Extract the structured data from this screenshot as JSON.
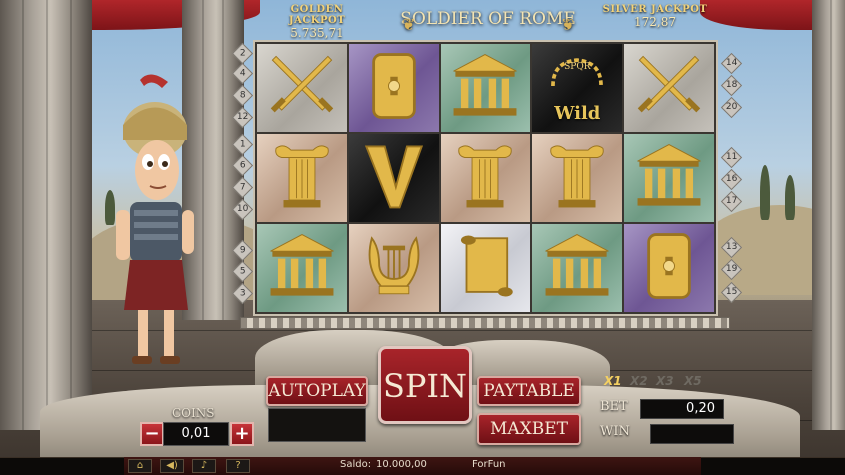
{
  "header": {
    "golden_jackpot_label": "GOLDEN JACKPOT",
    "golden_jackpot_value": "5.735,71",
    "title": "SOLDIER OF ROME",
    "silver_jackpot_label": "SILVER JACKPOT",
    "silver_jackpot_value": "172,87"
  },
  "paylines_left": [
    "2",
    "4",
    "8",
    "12",
    "1",
    "6",
    "7",
    "10",
    "9",
    "5",
    "3"
  ],
  "paylines_right": [
    "14",
    "18",
    "20",
    "11",
    "16",
    "17",
    "13",
    "19",
    "15"
  ],
  "reels": [
    [
      {
        "symbol": "crossed-swords",
        "bg": "gray"
      },
      {
        "symbol": "shield",
        "bg": "purple"
      },
      {
        "symbol": "temple",
        "bg": "green"
      },
      {
        "symbol": "spqr-wild",
        "bg": "black",
        "text": "Wild",
        "subtext": "SPQR"
      },
      {
        "symbol": "crossed-swords",
        "bg": "gray"
      }
    ],
    [
      {
        "symbol": "ionic-column",
        "bg": "tan"
      },
      {
        "symbol": "letter-v",
        "bg": "black"
      },
      {
        "symbol": "ionic-column",
        "bg": "tan"
      },
      {
        "symbol": "ionic-column",
        "bg": "tan"
      },
      {
        "symbol": "temple",
        "bg": "green"
      }
    ],
    [
      {
        "symbol": "temple",
        "bg": "green"
      },
      {
        "symbol": "lyre",
        "bg": "tan"
      },
      {
        "symbol": "scroll",
        "bg": "white"
      },
      {
        "symbol": "temple",
        "bg": "green"
      },
      {
        "symbol": "shield",
        "bg": "purple"
      }
    ]
  ],
  "controls": {
    "autoplay_label": "AUTOPLAY",
    "spin_label": "SPIN",
    "paytable_label": "PAYTABLE",
    "maxbet_label": "MAXBET",
    "coins_label": "COINS",
    "coins_value": "0,01",
    "minus": "−",
    "plus": "+",
    "multipliers": [
      "X1",
      "X2",
      "X3",
      "X5"
    ],
    "active_multiplier": "X1",
    "bet_label": "BET",
    "bet_value": "0,20",
    "win_label": "WIN",
    "win_value": ""
  },
  "footer": {
    "saldo_label": "Saldo:",
    "saldo_value": "10.000,00",
    "mode": "ForFun",
    "icons": [
      "temple-icon",
      "sound-icon",
      "music-icon",
      "help-icon"
    ],
    "help_glyph": "?"
  },
  "colors": {
    "gold": "#f3d37a",
    "button_red": "#a8242a",
    "panel": "#0d0c0b"
  }
}
